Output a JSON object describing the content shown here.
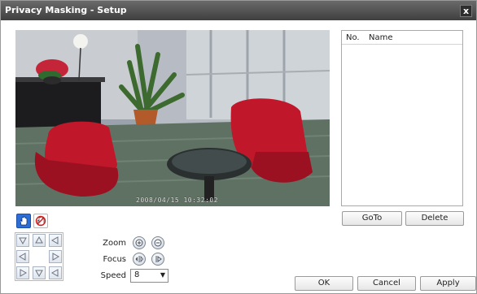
{
  "window": {
    "title": "Privacy Masking - Setup",
    "close_label": "x"
  },
  "video": {
    "timestamp": "2008/04/15 10:32:02"
  },
  "mask_list": {
    "columns": [
      "No.",
      "Name"
    ],
    "rows": []
  },
  "list_buttons": {
    "goto": "GoTo",
    "delete": "Delete"
  },
  "tools": [
    {
      "icon": "hand-icon",
      "active": true
    },
    {
      "icon": "draw-mask-icon",
      "active": false
    }
  ],
  "controls": {
    "zoom_label": "Zoom",
    "focus_label": "Focus",
    "speed_label": "Speed",
    "speed_value": "8"
  },
  "dialog_buttons": {
    "ok": "OK",
    "cancel": "Cancel",
    "apply": "Apply"
  },
  "colors": {
    "titlebar": "#4a4a4a",
    "active_tool": "#2c6dd6",
    "chair_red": "#c0182a"
  }
}
